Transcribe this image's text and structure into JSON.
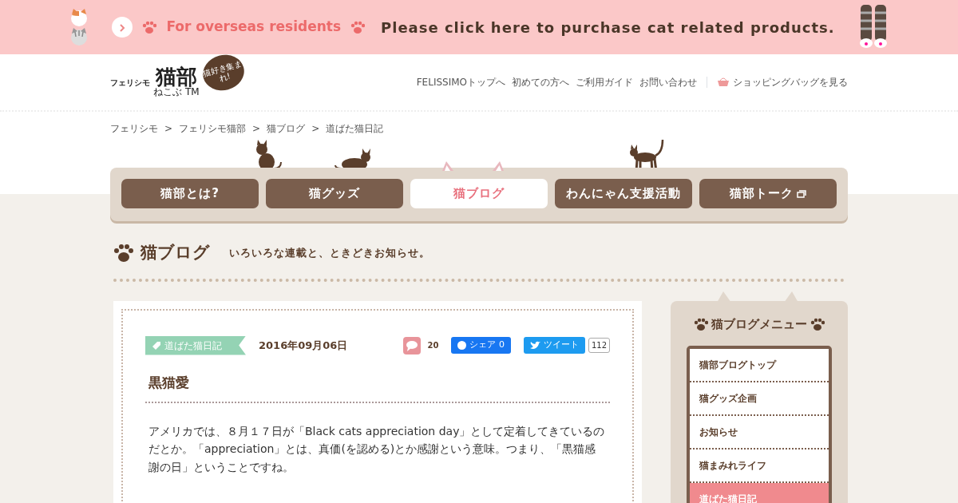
{
  "banner": {
    "tag": "For overseas residents",
    "message": "Please click here to purchase cat related products."
  },
  "logo": {
    "brand": "フェリシモ",
    "name": "猫部",
    "reading": "ねこぶ",
    "tm": "TM",
    "bubble": "猫好き集まれ!"
  },
  "header_links": [
    "FELISSIMOトップへ",
    "初めての方へ",
    "ご利用ガイド",
    "お問い合わせ"
  ],
  "bag_link": "ショッピングバッグを見る",
  "breadcrumb": {
    "separator": ">",
    "items": [
      "フェリシモ",
      "フェリシモ猫部",
      "猫ブログ",
      "道ばた猫日記"
    ]
  },
  "nav": [
    {
      "label": "猫部とは?",
      "selected": false,
      "external": false
    },
    {
      "label": "猫グッズ",
      "selected": false,
      "external": false
    },
    {
      "label": "猫ブログ",
      "selected": true,
      "external": false
    },
    {
      "label": "わんにゃん支援活動",
      "selected": false,
      "external": false
    },
    {
      "label": "猫部トーク",
      "selected": false,
      "external": true
    }
  ],
  "section": {
    "title": "猫ブログ",
    "subtitle": "いろいろな連載と、ときどきお知らせ。"
  },
  "post": {
    "category": "道ばた猫日記",
    "date": "2016年09月06日",
    "comments": "20",
    "share_label": "シェア",
    "share_count": "0",
    "tweet_label": "ツイート",
    "tweet_count": "112",
    "title": "黒猫愛",
    "body": "アメリカでは、８月１７日が「Black cats appreciation day」として定着してきているのだとか。「appreciation」とは、真価(を認める)とか感謝という意味。つまり、「黒猫感謝の日」ということですね。"
  },
  "sidebar": {
    "title": "猫ブログメニュー",
    "items": [
      {
        "label": "猫部ブログトップ",
        "selected": false
      },
      {
        "label": "猫グッズ企画",
        "selected": false
      },
      {
        "label": "お知らせ",
        "selected": false
      },
      {
        "label": "猫まみれライフ",
        "selected": false
      },
      {
        "label": "道ばた猫日記",
        "selected": true
      }
    ]
  }
}
